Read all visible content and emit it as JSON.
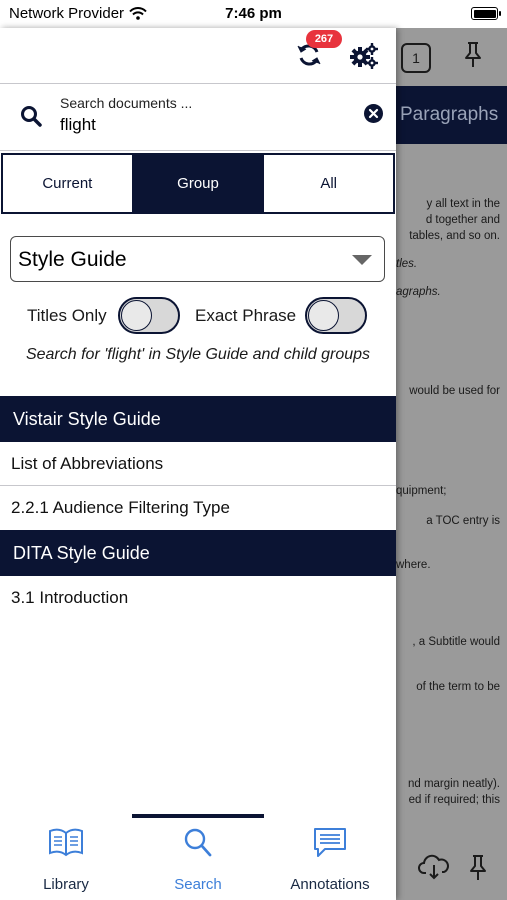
{
  "status_bar": {
    "carrier": "Network Provider",
    "time": "7:46 pm"
  },
  "background_doc": {
    "page_count": "1",
    "header_title": "Paragraphs",
    "lines": [
      {
        "text": "y all text in the",
        "style": "right"
      },
      {
        "text": "d together and",
        "style": "right"
      },
      {
        "text": "tables, and so on.",
        "style": "right"
      },
      {
        "text": "tles.",
        "style": "left-italic"
      },
      {
        "text": "agraphs.",
        "style": "left-italic"
      },
      {
        "text": "would be used for",
        "style": "right"
      },
      {
        "text": "quipment;",
        "style": "left"
      },
      {
        "text": "a TOC entry is",
        "style": "right"
      },
      {
        "text": "where.",
        "style": "left"
      },
      {
        "text": ", a Subtitle would",
        "style": "right"
      },
      {
        "text": "of the term to be",
        "style": "right"
      },
      {
        "text": "nd margin neatly).",
        "style": "right"
      },
      {
        "text": "ed if required; this",
        "style": "right"
      }
    ]
  },
  "toolbar": {
    "sync_badge": "267"
  },
  "search": {
    "label": "Search documents ...",
    "value": "flight"
  },
  "scope_tabs": [
    {
      "label": "Current",
      "active": false
    },
    {
      "label": "Group",
      "active": true
    },
    {
      "label": "All",
      "active": false
    }
  ],
  "group_select": {
    "value": "Style Guide"
  },
  "options": {
    "titles_only_label": "Titles Only",
    "exact_phrase_label": "Exact Phrase"
  },
  "hint": "Search for 'flight' in Style Guide and child groups",
  "results": [
    {
      "group": "Vistair Style Guide",
      "items": [
        "List of Abbreviations",
        "2.2.1 Audience Filtering Type"
      ]
    },
    {
      "group": "DITA Style Guide",
      "items": [
        "3.1 Introduction"
      ]
    }
  ],
  "tabbar": [
    {
      "label": "Library",
      "icon": "book-icon",
      "active": false
    },
    {
      "label": "Search",
      "icon": "search-icon",
      "active": true
    },
    {
      "label": "Annotations",
      "icon": "annotations-icon",
      "active": false
    }
  ],
  "colors": {
    "navy": "#0b1433",
    "badge_red": "#e8333d",
    "tab_active_blue": "#3d7fd9"
  }
}
